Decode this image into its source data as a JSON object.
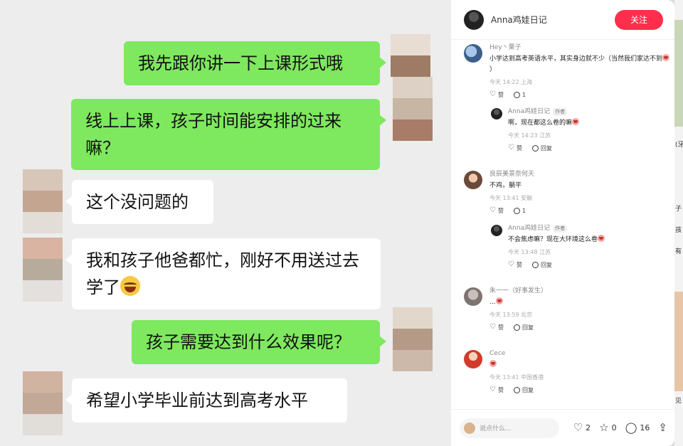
{
  "chat": {
    "messages": [
      {
        "side": "me",
        "text": "我先跟你讲一下上课形式哦"
      },
      {
        "side": "me",
        "text": "线上上课，孩子时间能安排的过来嘛？"
      },
      {
        "side": "other",
        "text": "这个没问题的"
      },
      {
        "side": "other",
        "text": "我和孩子他爸都忙，刚好不用送过去学了"
      },
      {
        "side": "me",
        "text": "孩子需要达到什么效果呢？"
      },
      {
        "side": "other",
        "text": "希望小学毕业前达到高考水平"
      }
    ]
  },
  "panel": {
    "author_name": "Anna鸡娃日记",
    "follow_label": "关注",
    "comments": [
      {
        "name": "Hey丶栗子",
        "text": "小学达到高考英语水平，其实身边就不少（当然我们家达不到",
        "time": "今天 14:22 上海",
        "like": "赞",
        "reply_count": "1"
      },
      {
        "name": "良辰美景奈何天",
        "text": "不鸡，躺平",
        "time": "今天 13:41 安徽",
        "like": "赞",
        "reply_count": "1"
      },
      {
        "name": "朱一一（好事发生）",
        "text": "...",
        "time": "今天 13:59 北京",
        "like": "赞",
        "reply_label": "回复"
      },
      {
        "name": "Cece",
        "text": "",
        "time": "今天 13:41 中国香港",
        "like": "赞",
        "reply_label": "回复"
      }
    ],
    "replies": [
      {
        "name": "Anna鸡娃日记",
        "tag": "作者",
        "text": "啊，现在都这么卷的嘛",
        "time": "今天 14:23 江苏",
        "like": "赞",
        "reply_label": "回复"
      },
      {
        "name": "Anna鸡娃日记",
        "tag": "作者",
        "text": "不会焦虑嘛？现在大环境这么卷",
        "time": "今天 13:48 江苏",
        "like": "赞",
        "reply_label": "回复"
      }
    ],
    "footer": {
      "input_placeholder": "说点什么...",
      "likes": "2",
      "stars": "0",
      "comments": "16"
    }
  },
  "edge_text": [
    "(牙",
    "子",
    "孩",
    "有",
    "见"
  ]
}
